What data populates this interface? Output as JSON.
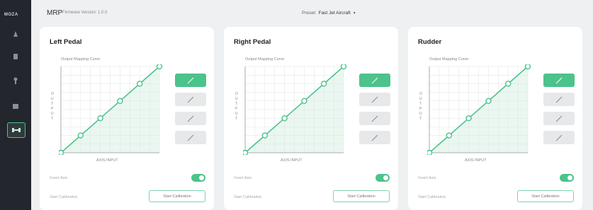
{
  "app": {
    "logo_text": "MOZA",
    "product": "MRP",
    "firmware": "Firmware Version: 1.0.0",
    "preset_label": "Preset:",
    "preset_value": "Fast Jet Aircraft"
  },
  "sidebar": {
    "items": [
      {
        "name": "pedal-device-icon",
        "active": false
      },
      {
        "name": "throttle-device-icon",
        "active": false
      },
      {
        "name": "stick-device-icon",
        "active": false
      },
      {
        "name": "joystick-base-icon",
        "active": false
      },
      {
        "name": "rudder-pedals-icon",
        "active": true
      }
    ]
  },
  "panels": [
    {
      "title": "Left Pedal",
      "curve_title": "Output Mapping Curve",
      "y_axis_letters": [
        "O",
        "U",
        "T",
        "P",
        "U",
        "T"
      ],
      "x_axis_label": "AXIS INPUT",
      "invert_label": "Invert Axis",
      "invert_on": true,
      "calibration_label": "Start Calibration",
      "calibration_button": "Start Calibration",
      "active_curve": 0,
      "curve_points": [
        [
          0,
          0
        ],
        [
          20,
          20
        ],
        [
          40,
          40
        ],
        [
          60,
          60
        ],
        [
          80,
          80
        ],
        [
          100,
          100
        ]
      ]
    },
    {
      "title": "Right Pedal",
      "curve_title": "Output Mapping Curve",
      "y_axis_letters": [
        "O",
        "U",
        "T",
        "P",
        "U",
        "T"
      ],
      "x_axis_label": "AXIS INPUT",
      "invert_label": "Invert Axis",
      "invert_on": true,
      "calibration_label": "Start Calibration",
      "calibration_button": "Start Calibration",
      "active_curve": 0,
      "curve_points": [
        [
          0,
          0
        ],
        [
          20,
          20
        ],
        [
          40,
          40
        ],
        [
          60,
          60
        ],
        [
          80,
          80
        ],
        [
          100,
          100
        ]
      ]
    },
    {
      "title": "Rudder",
      "curve_title": "Output Mapping Curve",
      "y_axis_letters": [
        "O",
        "U",
        "T",
        "P",
        "U",
        "T"
      ],
      "x_axis_label": "AXIS INPUT",
      "invert_label": "Invert Axis",
      "invert_on": true,
      "calibration_label": "Start Calibration",
      "calibration_button": "Start Calibration",
      "active_curve": 0,
      "curve_points": [
        [
          0,
          0
        ],
        [
          20,
          20
        ],
        [
          40,
          40
        ],
        [
          60,
          60
        ],
        [
          80,
          80
        ],
        [
          100,
          100
        ]
      ]
    }
  ],
  "colors": {
    "accent": "#4cc38a",
    "sidebar_bg": "#23262d",
    "grid_fill": "#eaf7f0"
  }
}
